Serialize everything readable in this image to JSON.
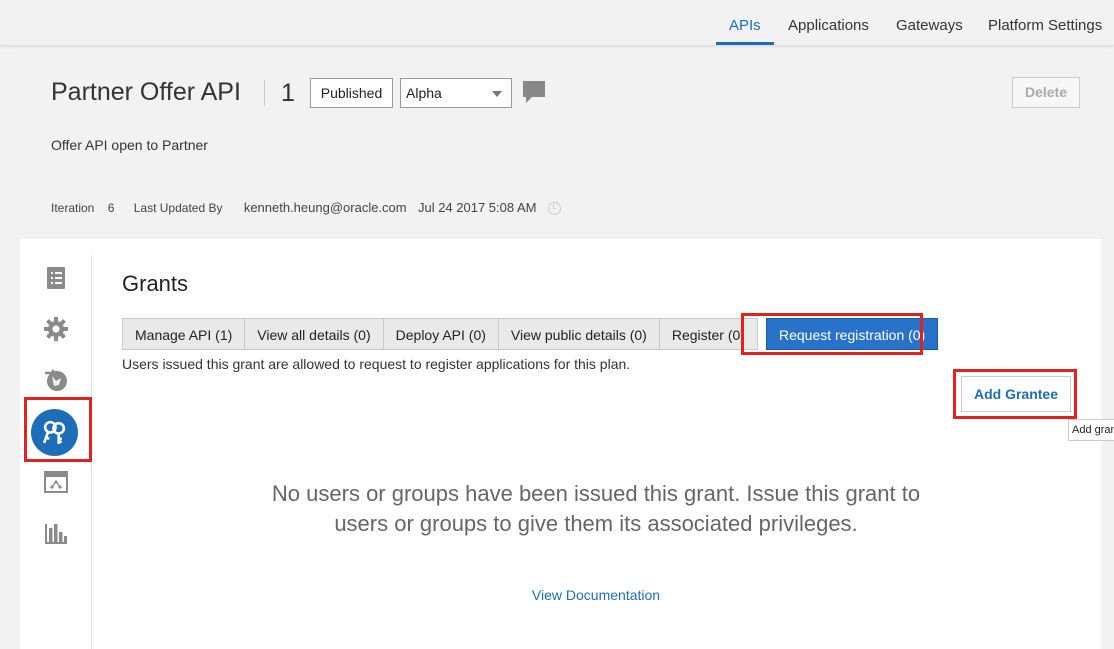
{
  "nav": {
    "items": [
      {
        "label": "APIs",
        "active": true
      },
      {
        "label": "Applications",
        "active": false
      },
      {
        "label": "Gateways",
        "active": false
      },
      {
        "label": "Platform Settings",
        "active": false
      }
    ]
  },
  "api": {
    "title": "Partner Offer API",
    "version": "1",
    "state": "Published",
    "stage": "Alpha",
    "delete_label": "Delete",
    "description": "Offer API open to Partner",
    "iteration_label": "Iteration",
    "iteration": "6",
    "last_updated_label": "Last Updated By",
    "last_updated_by": "kenneth.heung@oracle.com",
    "last_updated_at": "Jul 24 2017 5:08 AM"
  },
  "sidebar": {
    "items": [
      {
        "icon": "api-details-icon",
        "active": false
      },
      {
        "icon": "settings-icon",
        "active": false
      },
      {
        "icon": "deployments-icon",
        "active": false
      },
      {
        "icon": "grants-icon",
        "active": true
      },
      {
        "icon": "api-portal-icon",
        "active": false
      },
      {
        "icon": "analytics-icon",
        "active": false
      }
    ]
  },
  "grants": {
    "title": "Grants",
    "tabs": [
      {
        "label": "Manage API (1)",
        "active": false
      },
      {
        "label": "View all details (0)",
        "active": false
      },
      {
        "label": "Deploy API (0)",
        "active": false
      },
      {
        "label": "View public details (0)",
        "active": false
      },
      {
        "label": "Register (0)",
        "active": false
      },
      {
        "label": "Request registration (0)",
        "active": true
      }
    ],
    "description": "Users issued this grant are allowed to request to register applications for this plan.",
    "add_grantee_label": "Add Grantee",
    "tooltip": "Add gran",
    "empty_message": "No users or groups have been issued this grant. Issue this grant to users or groups to give them its associated privileges.",
    "doc_link": "View Documentation"
  },
  "colors": {
    "accent": "#1d6db8",
    "active_tab": "#2872c9",
    "highlight": "#e0231b"
  }
}
